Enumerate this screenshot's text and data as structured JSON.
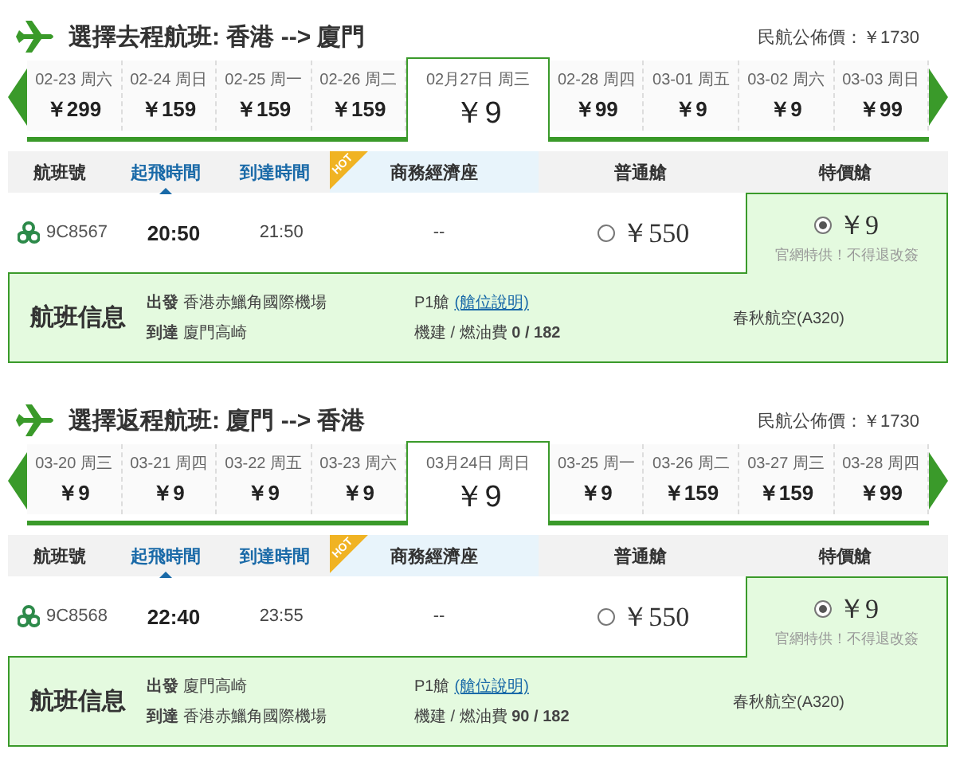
{
  "sections": [
    {
      "title": "選擇去程航班: 香港 --> 廈門",
      "official_price": "民航公佈價：￥1730",
      "dates": [
        {
          "date": "02-23 周六",
          "price": "￥299",
          "selected": false
        },
        {
          "date": "02-24 周日",
          "price": "￥159",
          "selected": false
        },
        {
          "date": "02-25 周一",
          "price": "￥159",
          "selected": false
        },
        {
          "date": "02-26 周二",
          "price": "￥159",
          "selected": false
        },
        {
          "date": "02月27日 周三",
          "price": "￥9",
          "selected": true
        },
        {
          "date": "02-28 周四",
          "price": "￥99",
          "selected": false
        },
        {
          "date": "03-01 周五",
          "price": "￥9",
          "selected": false
        },
        {
          "date": "03-02 周六",
          "price": "￥9",
          "selected": false
        },
        {
          "date": "03-03 周日",
          "price": "￥99",
          "selected": false
        }
      ],
      "columns": [
        {
          "label": "航班號",
          "kind": "plain"
        },
        {
          "label": "起飛時間",
          "kind": "sorted"
        },
        {
          "label": "到達時間",
          "kind": "link"
        },
        {
          "label": "商務經濟座",
          "kind": "hot",
          "badge": "HOT"
        },
        {
          "label": "普通艙",
          "kind": "plain"
        },
        {
          "label": "特價艙",
          "kind": "plain"
        }
      ],
      "flight": {
        "number": "9C8567",
        "depart": "20:50",
        "arrive": "21:50",
        "business": "--",
        "fares": [
          {
            "price": "￥550",
            "selected": false
          },
          {
            "price": "￥9",
            "note": "官網特供！不得退改簽",
            "selected": true
          }
        ]
      },
      "info": {
        "heading": "航班信息",
        "departure": "**出發** 香港赤鱲角國際機場",
        "arrival": "**到達** 廈門高崎",
        "cabin": "P1艙",
        "cabin_link": "(艙位說明)",
        "fees": "機建 / 燃油費 **0 / 182**",
        "airline": "春秋航空(A320)"
      }
    },
    {
      "title": "選擇返程航班: 廈門 --> 香港",
      "official_price": "民航公佈價：￥1730",
      "dates": [
        {
          "date": "03-20 周三",
          "price": "￥9",
          "selected": false
        },
        {
          "date": "03-21 周四",
          "price": "￥9",
          "selected": false
        },
        {
          "date": "03-22 周五",
          "price": "￥9",
          "selected": false
        },
        {
          "date": "03-23 周六",
          "price": "￥9",
          "selected": false
        },
        {
          "date": "03月24日 周日",
          "price": "￥9",
          "selected": true
        },
        {
          "date": "03-25 周一",
          "price": "￥9",
          "selected": false
        },
        {
          "date": "03-26 周二",
          "price": "￥159",
          "selected": false
        },
        {
          "date": "03-27 周三",
          "price": "￥159",
          "selected": false
        },
        {
          "date": "03-28 周四",
          "price": "￥99",
          "selected": false
        }
      ],
      "columns": [
        {
          "label": "航班號",
          "kind": "plain"
        },
        {
          "label": "起飛時間",
          "kind": "sorted"
        },
        {
          "label": "到達時間",
          "kind": "link"
        },
        {
          "label": "商務經濟座",
          "kind": "hot",
          "badge": "HOT"
        },
        {
          "label": "普通艙",
          "kind": "plain"
        },
        {
          "label": "特價艙",
          "kind": "plain"
        }
      ],
      "flight": {
        "number": "9C8568",
        "depart": "22:40",
        "arrive": "23:55",
        "business": "--",
        "fares": [
          {
            "price": "￥550",
            "selected": false
          },
          {
            "price": "￥9",
            "note": "官網特供！不得退改簽",
            "selected": true
          }
        ]
      },
      "info": {
        "heading": "航班信息",
        "departure": "**出發** 廈門高崎",
        "arrival": "**到達** 香港赤鱲角國際機場",
        "cabin": "P1艙",
        "cabin_link": "(艙位說明)",
        "fees": "機建 / 燃油費 **90 / 182**",
        "airline": "春秋航空(A320)"
      }
    }
  ]
}
